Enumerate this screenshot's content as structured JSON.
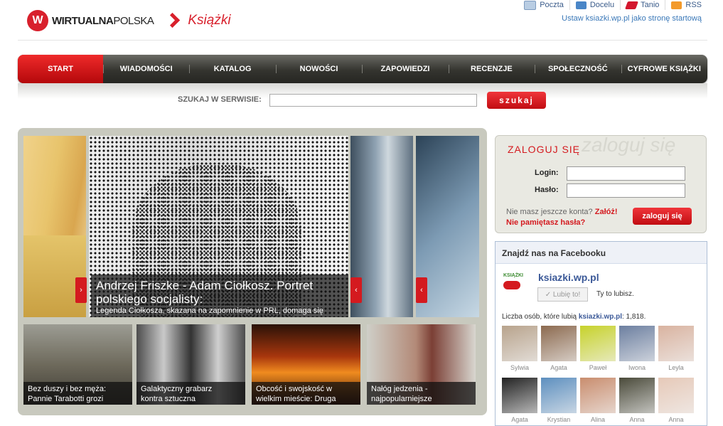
{
  "top_links": [
    {
      "label": "Poczta",
      "icon": "mail-icon"
    },
    {
      "label": "Docelu",
      "icon": "doc-icon"
    },
    {
      "label": "Tanio",
      "icon": "tanio-icon"
    },
    {
      "label": "RSS",
      "icon": "rss-icon"
    }
  ],
  "start_page_link": "Ustaw ksiazki.wp.pl jako stronę startową",
  "logo": {
    "mark": "W",
    "text_bold": "WIRTUALNA",
    "text_normal": "POLSKA",
    "section": "Książki"
  },
  "nav": [
    "START",
    "WIADOMOŚCI",
    "KATALOG",
    "NOWOŚCI",
    "ZAPOWIEDZI",
    "RECENZJE",
    "SPOŁECZNOŚĆ",
    "CYFROWE KSIĄŻKI"
  ],
  "search": {
    "label": "SZUKAJ W SERWISIE:",
    "value": "",
    "button": "szukaj"
  },
  "featured": {
    "title": "Andrzej Friszke - Adam Ciołkosz. Portret polskiego socjalisty:",
    "subtitle": "Legenda Ciołkosza, skazana na zapomnienie w PRL, domaga się",
    "arrow": "›"
  },
  "thumbs": [
    {
      "line1": "Bez duszy i bez męża:",
      "line2": "Pannie Tarabotti grozi"
    },
    {
      "line1": "Galaktyczny grabarz",
      "line2": "kontra sztuczna"
    },
    {
      "line1": "Obcość i swojskość w",
      "line2": "wielkim mieście: Druga"
    },
    {
      "line1": "Nałóg jedzenia -",
      "line2": "najpopularniejsze"
    }
  ],
  "login": {
    "title": "ZALOGUJ SIĘ",
    "deco": "zaloguj się",
    "login_label": "Login:",
    "password_label": "Hasło:",
    "no_account": "Nie masz jeszcze konta?",
    "register": "Załóż!",
    "forgot": "Nie pamiętasz hasła?",
    "button": "zaloguj się"
  },
  "facebook": {
    "title": "Znajdź nas na Facebooku",
    "logo_text": "KSIĄŻKI",
    "page_name": "ksiazki.wp.pl",
    "like_button": "✓ Lubię to!",
    "you_like": "Ty to lubisz.",
    "count_prefix": "Liczba osób, które lubią",
    "count_page": "ksiazki.wp.pl",
    "count_value": ": 1,818.",
    "fans": [
      {
        "name": "Sylwia",
        "color": "#b8a38c"
      },
      {
        "name": "Agata",
        "color": "#8c6a4f"
      },
      {
        "name": "Paweł",
        "color": "#c7d22b"
      },
      {
        "name": "Iwona",
        "color": "#6c7fa0"
      },
      {
        "name": "Leyla",
        "color": "#d9b3a0"
      },
      {
        "name": "Agata",
        "color": "#222222"
      },
      {
        "name": "Krystian",
        "color": "#5d8fbf"
      },
      {
        "name": "Alina",
        "color": "#c98d6e"
      },
      {
        "name": "Anna",
        "color": "#4a4a3a"
      },
      {
        "name": "Anna",
        "color": "#e6c9b8"
      }
    ]
  }
}
